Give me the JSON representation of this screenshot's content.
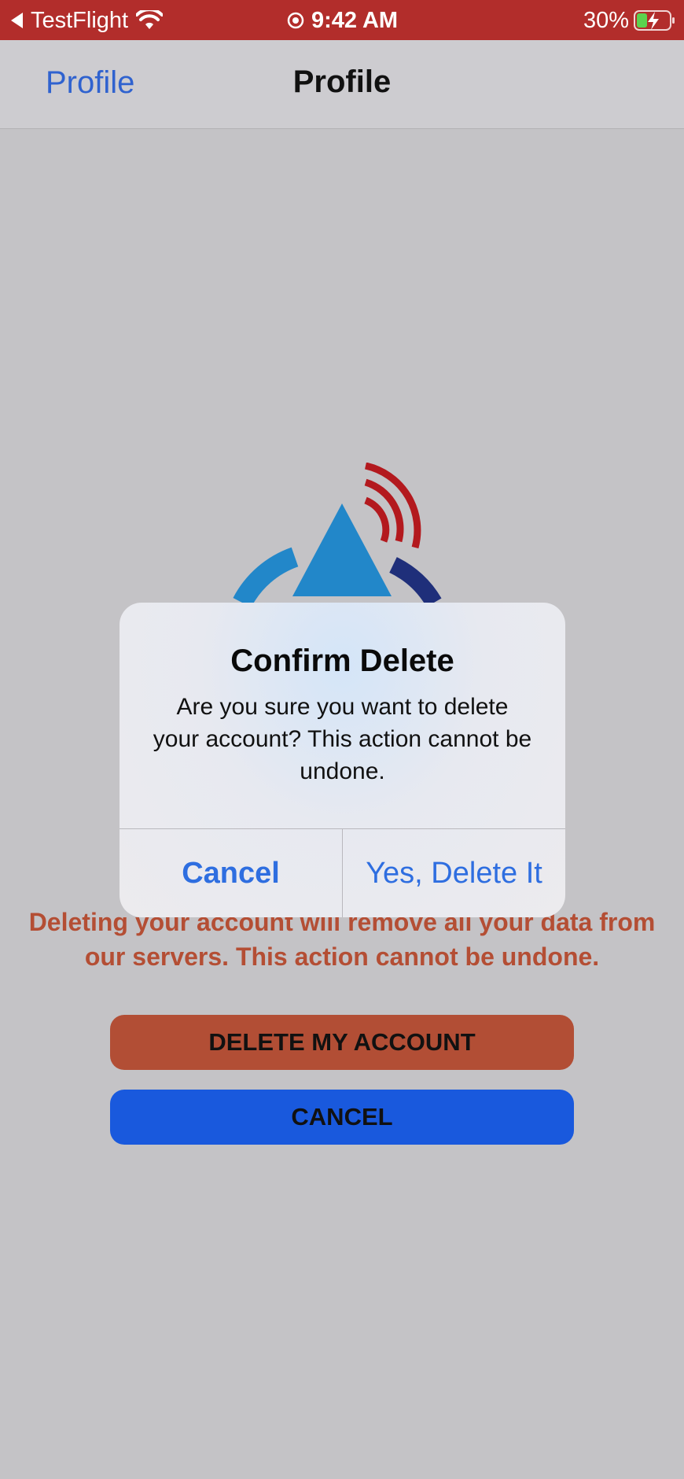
{
  "status_bar": {
    "back_app": "TestFlight",
    "time": "9:42 AM",
    "battery_percent": "30%"
  },
  "nav": {
    "back_label": "Profile",
    "title": "Profile"
  },
  "warning_text": "Deleting your account will remove all your data from our servers. This action cannot be undone.",
  "buttons": {
    "delete_account": "DELETE MY ACCOUNT",
    "cancel": "CANCEL"
  },
  "alert": {
    "title": "Confirm Delete",
    "message": "Are you sure you want to delete your account? This action cannot be undone.",
    "cancel_label": "Cancel",
    "confirm_label": "Yes, Delete It"
  },
  "colors": {
    "status_bar": "#b22d2b",
    "link_blue": "#2f62cf",
    "danger": "#b44e34",
    "cancel_blue": "#1959dd",
    "logo_blue": "#2287c9",
    "logo_red": "#b3191e",
    "logo_navy": "#1f2f7a"
  },
  "icons": {
    "status_back": "back-arrow-icon",
    "wifi": "wifi-icon",
    "location": "location-icon",
    "battery": "battery-charging-icon",
    "logo": "app-logo"
  }
}
